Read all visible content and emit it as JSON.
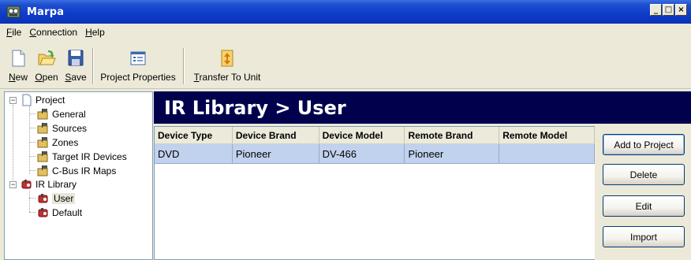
{
  "window": {
    "title": "Marpa"
  },
  "menu": [
    {
      "label_u": "F",
      "label_rest": "ile"
    },
    {
      "label_u": "C",
      "label_rest": "onnection"
    },
    {
      "label_u": "H",
      "label_rest": "elp"
    }
  ],
  "toolbar": {
    "new_u": "N",
    "new_rest": "ew",
    "open_u": "O",
    "open_rest": "pen",
    "save_u": "S",
    "save_rest": "ave",
    "project_properties_pre": "Pro",
    "project_properties_u": "j",
    "project_properties_rest": "ect Properties",
    "transfer_u": "T",
    "transfer_rest": "ransfer To Unit"
  },
  "tree": {
    "project": "Project",
    "general": "General",
    "sources": "Sources",
    "zones": "Zones",
    "target_ir": "Target IR Devices",
    "cbus_ir": "C-Bus IR Maps",
    "ir_library": "IR Library",
    "user": "User",
    "default": "Default"
  },
  "header": {
    "title": "IR Library > User"
  },
  "list": {
    "columns": [
      "Device Type",
      "Device Brand",
      "Device Model",
      "Remote Brand",
      "Remote Model"
    ],
    "rows": [
      [
        "DVD",
        "Pioneer",
        "DV-466",
        "Pioneer",
        ""
      ]
    ]
  },
  "buttons": {
    "add": "Add to Project",
    "delete": "Delete",
    "edit": "Edit",
    "import": "Import"
  },
  "colors": {
    "header_bg": "#00004d",
    "selection": "#c1d2ee",
    "titlebar": "#0d3bc8"
  }
}
